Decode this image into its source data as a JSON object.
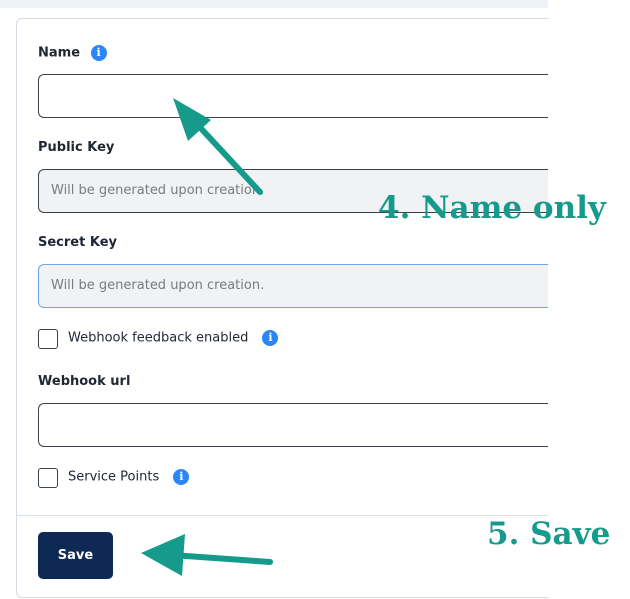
{
  "form": {
    "name_label": "Name",
    "public_key_label": "Public Key",
    "public_key_placeholder": "Will be generated upon creation.",
    "secret_key_label": "Secret Key",
    "secret_key_placeholder": "Will be generated upon creation.",
    "webhook_feedback_label": "Webhook feedback enabled",
    "webhook_url_label": "Webhook url",
    "service_points_label": "Service Points",
    "info_glyph": "i",
    "save_label": "Save"
  },
  "annotations": {
    "step4": "4. Name only",
    "step5": "5. Save"
  },
  "colors": {
    "annotation": "#169a8c",
    "info_icon": "#2a86f5",
    "save_button": "#0f2955"
  }
}
